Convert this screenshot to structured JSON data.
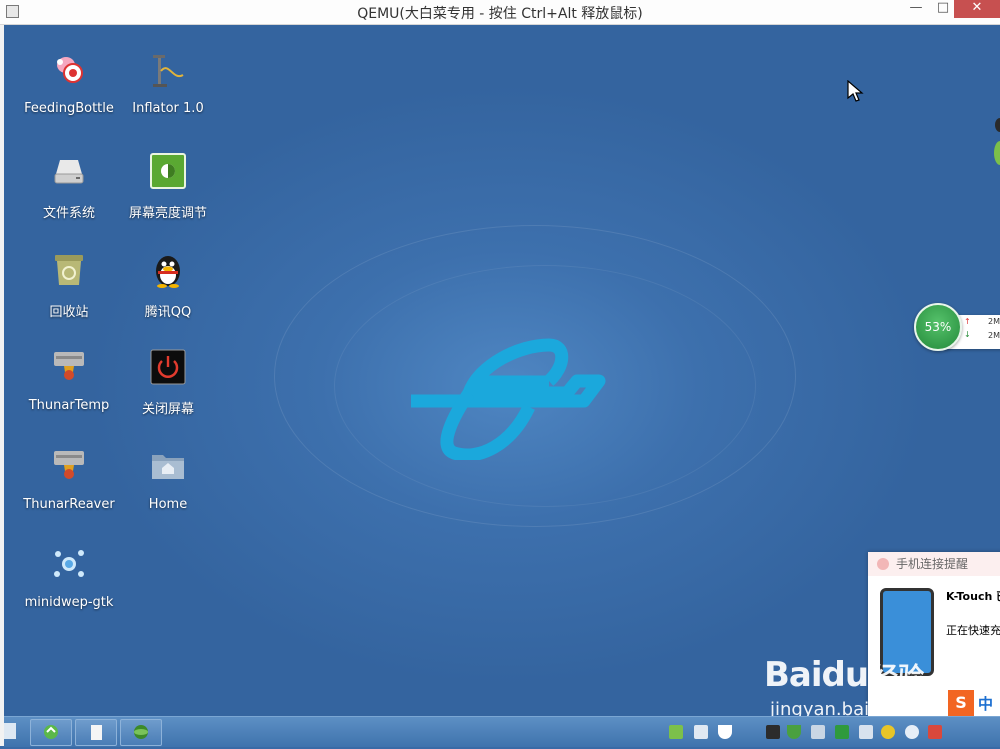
{
  "window": {
    "title": "QEMU(大白菜专用 - 按住 Ctrl+Alt 释放鼠标)",
    "controls": {
      "minimize": "—",
      "maximize": "□",
      "close": "✕"
    }
  },
  "desktop": {
    "icons": [
      {
        "label": "FeedingBottle",
        "icon": "feeding-bottle-icon"
      },
      {
        "label": "Inflator 1.0",
        "icon": "inflator-icon"
      },
      {
        "label": "文件系统",
        "icon": "drive-icon"
      },
      {
        "label": "屏幕亮度调节",
        "icon": "brightness-icon"
      },
      {
        "label": "回收站",
        "icon": "recycle-bin-icon"
      },
      {
        "label": "腾讯QQ",
        "icon": "qq-penguin-icon"
      },
      {
        "label": "ThunarTemp",
        "icon": "file-manager-icon"
      },
      {
        "label": "关闭屏幕",
        "icon": "power-icon"
      },
      {
        "label": "ThunarReaver",
        "icon": "file-manager-icon"
      },
      {
        "label": "Home",
        "icon": "home-folder-icon"
      },
      {
        "label": "minidwep-gtk",
        "icon": "splash-icon"
      }
    ]
  },
  "net_widget": {
    "percent": "53%",
    "upload": "2M",
    "download": "2M",
    "up_arrow": "↑",
    "down_arrow": "↓"
  },
  "popup": {
    "title": "手机连接提醒",
    "device": "K-Touch 已",
    "status": "正在快速充"
  },
  "watermark": {
    "brand": "Baidu",
    "suffix": "经验",
    "url": "jingyan.baidu.com"
  },
  "ime": {
    "logo": "S",
    "mode": "中"
  },
  "taskbar": {
    "buttons": [
      "app-button",
      "document-button",
      "globe-button"
    ],
    "accent": "#3f73ad"
  }
}
